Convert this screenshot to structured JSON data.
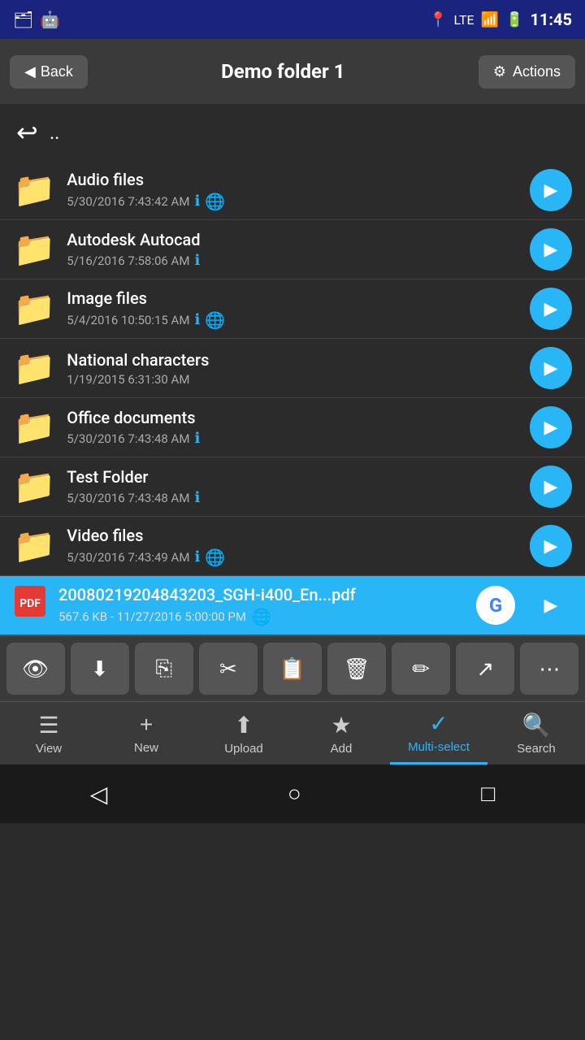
{
  "statusBar": {
    "time": "11:45",
    "icons": [
      "📶",
      "🔋"
    ]
  },
  "header": {
    "backLabel": "Back",
    "title": "Demo folder 1",
    "actionsLabel": "Actions"
  },
  "parentDir": {
    "symbol": ".."
  },
  "files": [
    {
      "type": "folder",
      "name": "Audio files",
      "date": "5/30/2016 7:43:42 AM",
      "hasInfo": true,
      "hasGlobe": true
    },
    {
      "type": "folder",
      "name": "Autodesk Autocad",
      "date": "5/16/2016 7:58:06 AM",
      "hasInfo": true,
      "hasGlobe": false
    },
    {
      "type": "folder",
      "name": "Image files",
      "date": "5/4/2016 10:50:15 AM",
      "hasInfo": true,
      "hasGlobe": true
    },
    {
      "type": "folder",
      "name": "National characters",
      "date": "1/19/2015 6:31:30 AM",
      "hasInfo": false,
      "hasGlobe": false
    },
    {
      "type": "folder",
      "name": "Office documents",
      "date": "5/30/2016 7:43:48 AM",
      "hasInfo": true,
      "hasGlobe": false
    },
    {
      "type": "folder",
      "name": "Test Folder",
      "date": "5/30/2016 7:43:48 AM",
      "hasInfo": true,
      "hasGlobe": false
    },
    {
      "type": "folder",
      "name": "Video files",
      "date": "5/30/2016 7:43:49 AM",
      "hasInfo": true,
      "hasGlobe": true
    },
    {
      "type": "pdf",
      "name": "20080219204843203_SGH-i400_En...pdf",
      "date": "567.6 KB - 11/27/2016 5:00:00 PM",
      "hasInfo": false,
      "hasGlobe": true,
      "hasGoogle": true,
      "selected": true
    }
  ],
  "actionButtons": [
    {
      "name": "view-btn",
      "icon": "👁",
      "label": "view"
    },
    {
      "name": "download-btn",
      "icon": "⬇",
      "label": "download"
    },
    {
      "name": "copy-btn",
      "icon": "⎘",
      "label": "copy"
    },
    {
      "name": "cut-btn",
      "icon": "✂",
      "label": "cut"
    },
    {
      "name": "paste-btn",
      "icon": "📋",
      "label": "paste"
    },
    {
      "name": "delete-btn",
      "icon": "🗑",
      "label": "delete"
    },
    {
      "name": "edit-btn",
      "icon": "✏",
      "label": "edit"
    },
    {
      "name": "share-btn",
      "icon": "↗",
      "label": "share"
    },
    {
      "name": "more-btn",
      "icon": "⋯",
      "label": "more"
    }
  ],
  "bottomNav": [
    {
      "name": "view-nav",
      "icon": "☰",
      "label": "View",
      "active": false
    },
    {
      "name": "new-nav",
      "icon": "+",
      "label": "New",
      "active": false
    },
    {
      "name": "upload-nav",
      "icon": "⬆",
      "label": "Upload",
      "active": false
    },
    {
      "name": "add-nav",
      "icon": "★",
      "label": "Add",
      "active": false
    },
    {
      "name": "multiselect-nav",
      "icon": "✓",
      "label": "Multi-select",
      "active": true
    },
    {
      "name": "search-nav",
      "icon": "🔍",
      "label": "Search",
      "active": false
    }
  ],
  "sysNav": {
    "back": "◁",
    "home": "○",
    "recent": "□"
  }
}
